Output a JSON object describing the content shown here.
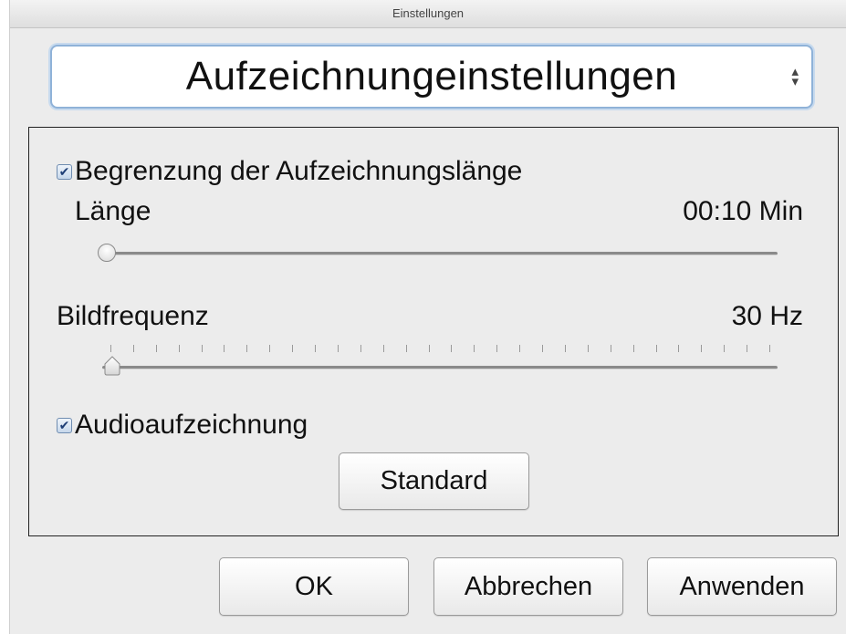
{
  "window": {
    "title": "Einstellungen"
  },
  "popup": {
    "selected": "Aufzeichnungeinstellungen"
  },
  "settings": {
    "limit_length": {
      "label": "Begrenzung der Aufzeichnungslänge",
      "checked": true
    },
    "length": {
      "label": "Länge",
      "value": "00:10 Min",
      "slider_fraction": 0.0
    },
    "framerate": {
      "label": "Bildfrequenz",
      "value": "30 Hz",
      "slider_fraction": 0.0
    },
    "audio": {
      "label": "Audioaufzeichnung",
      "checked": true
    },
    "standard_label": "Standard"
  },
  "buttons": {
    "ok": "OK",
    "cancel": "Abbrechen",
    "apply": "Anwenden"
  },
  "icons": {
    "checkmark": "✔",
    "popup_arrows": "up-down-arrows-icon"
  }
}
